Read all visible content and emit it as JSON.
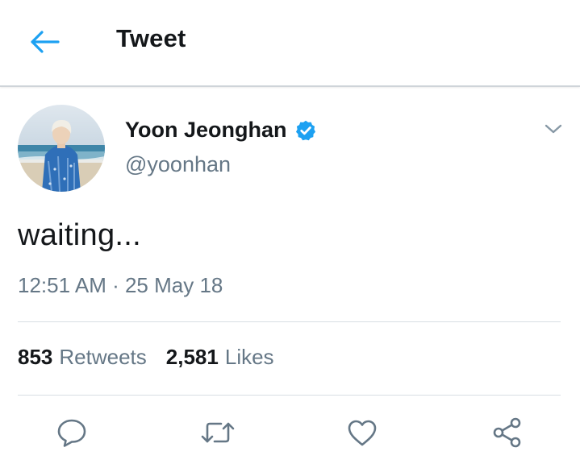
{
  "header": {
    "title": "Tweet",
    "back_icon": "arrow-left-icon"
  },
  "author": {
    "name": "Yoon Jeonghan",
    "handle": "@yoonhan",
    "verified": true,
    "avatar": "avatar-photo"
  },
  "tweet": {
    "text": "waiting...",
    "timestamp": "12:51 AM · 25 May 18"
  },
  "stats": {
    "retweets_count": "853",
    "retweets_label": "Retweets",
    "likes_count": "2,581",
    "likes_label": "Likes"
  },
  "actions": [
    {
      "name": "reply",
      "icon": "reply-icon"
    },
    {
      "name": "retweet",
      "icon": "retweet-icon"
    },
    {
      "name": "like",
      "icon": "heart-icon"
    },
    {
      "name": "share",
      "icon": "share-icon"
    }
  ],
  "colors": {
    "accent": "#1da1f2",
    "text_primary": "#14171a",
    "text_secondary": "#657786",
    "divider": "#d8dee3"
  }
}
